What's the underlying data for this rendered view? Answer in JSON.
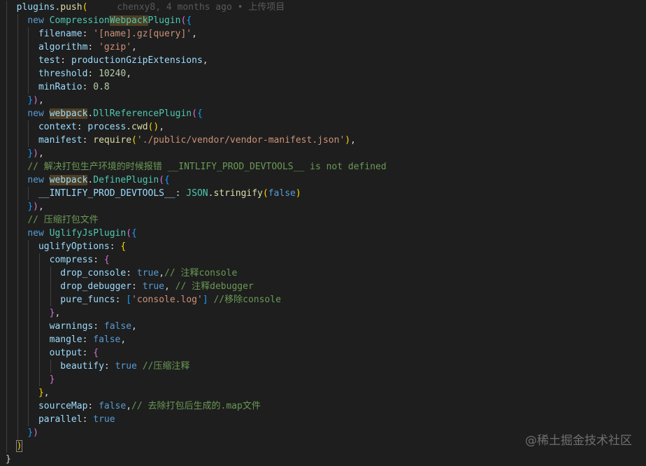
{
  "colors": {
    "background": "#1e1e1e",
    "default": "#d4d4d4",
    "keyword": "#569cd6",
    "class": "#4ec9b0",
    "function": "#dcdcaa",
    "property": "#9cdcfe",
    "string": "#ce9178",
    "number": "#b5cea8",
    "comment": "#6a9955",
    "bracket_gold": "#ffd700",
    "bracket_purple": "#da70d6",
    "bracket_blue": "#179fff",
    "blame": "#5a5a5a"
  },
  "blame": {
    "text": "chenxy8, 4 months ago • 上传项目"
  },
  "watermark": {
    "text": "@稀土掘金技术社区"
  },
  "lines": [
    {
      "indent": 2,
      "tokens": [
        [
          "plugins",
          "property"
        ],
        [
          ".",
          "default"
        ],
        [
          "push",
          "function"
        ],
        [
          "(",
          "bracket_gold"
        ]
      ],
      "blame": true
    },
    {
      "indent": 3,
      "tokens": [
        [
          "new ",
          "keyword"
        ],
        [
          "Compression",
          "class"
        ],
        [
          "Webpack",
          "class_hl"
        ],
        [
          "Plugin",
          "class"
        ],
        [
          "(",
          "bracket_purple"
        ],
        [
          "{",
          "bracket_blue"
        ]
      ]
    },
    {
      "indent": 4,
      "tokens": [
        [
          "filename",
          "property"
        ],
        [
          ": ",
          "default"
        ],
        [
          "'[name].gz[query]'",
          "string"
        ],
        [
          ",",
          "default"
        ]
      ]
    },
    {
      "indent": 4,
      "tokens": [
        [
          "algorithm",
          "property"
        ],
        [
          ": ",
          "default"
        ],
        [
          "'gzip'",
          "string"
        ],
        [
          ",",
          "default"
        ]
      ]
    },
    {
      "indent": 4,
      "tokens": [
        [
          "test",
          "property"
        ],
        [
          ": ",
          "default"
        ],
        [
          "productionGzipExtensions",
          "property"
        ],
        [
          ",",
          "default"
        ]
      ]
    },
    {
      "indent": 4,
      "tokens": [
        [
          "threshold",
          "property"
        ],
        [
          ": ",
          "default"
        ],
        [
          "10240",
          "number"
        ],
        [
          ",",
          "default"
        ]
      ]
    },
    {
      "indent": 4,
      "tokens": [
        [
          "minRatio",
          "property"
        ],
        [
          ": ",
          "default"
        ],
        [
          "0.8",
          "number"
        ]
      ]
    },
    {
      "indent": 3,
      "tokens": [
        [
          "}",
          "bracket_blue"
        ],
        [
          ")",
          "bracket_purple"
        ],
        [
          ",",
          "default"
        ]
      ]
    },
    {
      "indent": 3,
      "tokens": [
        [
          "new ",
          "keyword"
        ],
        [
          "webpack",
          "property_hl"
        ],
        [
          ".",
          "default"
        ],
        [
          "DllReferencePlugin",
          "class"
        ],
        [
          "(",
          "bracket_purple"
        ],
        [
          "{",
          "bracket_blue"
        ]
      ]
    },
    {
      "indent": 4,
      "tokens": [
        [
          "context",
          "property"
        ],
        [
          ": ",
          "default"
        ],
        [
          "process",
          "property"
        ],
        [
          ".",
          "default"
        ],
        [
          "cwd",
          "function"
        ],
        [
          "()",
          "bracket_gold"
        ],
        [
          ",",
          "default"
        ]
      ]
    },
    {
      "indent": 4,
      "tokens": [
        [
          "manifest",
          "property"
        ],
        [
          ": ",
          "default"
        ],
        [
          "require",
          "function"
        ],
        [
          "(",
          "bracket_gold"
        ],
        [
          "'./public/vendor/vendor-manifest.json'",
          "string"
        ],
        [
          ")",
          "bracket_gold"
        ],
        [
          ",",
          "default"
        ]
      ]
    },
    {
      "indent": 3,
      "tokens": [
        [
          "}",
          "bracket_blue"
        ],
        [
          ")",
          "bracket_purple"
        ],
        [
          ",",
          "default"
        ]
      ]
    },
    {
      "indent": 3,
      "tokens": [
        [
          "// 解决打包生产环境的时候报错 __INTLIFY_PROD_DEVTOOLS__ is not defined",
          "comment"
        ]
      ]
    },
    {
      "indent": 3,
      "tokens": [
        [
          "new ",
          "keyword"
        ],
        [
          "webpack",
          "property_hl"
        ],
        [
          ".",
          "default"
        ],
        [
          "DefinePlugin",
          "class"
        ],
        [
          "(",
          "bracket_purple"
        ],
        [
          "{",
          "bracket_blue"
        ]
      ]
    },
    {
      "indent": 4,
      "tokens": [
        [
          "__INTLIFY_PROD_DEVTOOLS__",
          "property"
        ],
        [
          ": ",
          "default"
        ],
        [
          "JSON",
          "class"
        ],
        [
          ".",
          "default"
        ],
        [
          "stringify",
          "function"
        ],
        [
          "(",
          "bracket_gold"
        ],
        [
          "false",
          "keyword"
        ],
        [
          ")",
          "bracket_gold"
        ]
      ]
    },
    {
      "indent": 3,
      "tokens": [
        [
          "}",
          "bracket_blue"
        ],
        [
          ")",
          "bracket_purple"
        ],
        [
          ",",
          "default"
        ]
      ]
    },
    {
      "indent": 3,
      "tokens": [
        [
          "// 压缩打包文件",
          "comment"
        ]
      ]
    },
    {
      "indent": 3,
      "tokens": [
        [
          "new ",
          "keyword"
        ],
        [
          "UglifyJsPlugin",
          "class"
        ],
        [
          "(",
          "bracket_purple"
        ],
        [
          "{",
          "bracket_blue"
        ]
      ]
    },
    {
      "indent": 4,
      "tokens": [
        [
          "uglifyOptions",
          "property"
        ],
        [
          ": ",
          "default"
        ],
        [
          "{",
          "bracket_gold"
        ]
      ]
    },
    {
      "indent": 5,
      "tokens": [
        [
          "compress",
          "property"
        ],
        [
          ": ",
          "default"
        ],
        [
          "{",
          "bracket_purple"
        ]
      ]
    },
    {
      "indent": 6,
      "tokens": [
        [
          "drop_console",
          "property"
        ],
        [
          ": ",
          "default"
        ],
        [
          "true",
          "keyword"
        ],
        [
          ",",
          "default"
        ],
        [
          "// 注释console",
          "comment"
        ]
      ]
    },
    {
      "indent": 6,
      "tokens": [
        [
          "drop_debugger",
          "property"
        ],
        [
          ": ",
          "default"
        ],
        [
          "true",
          "keyword"
        ],
        [
          ", ",
          "default"
        ],
        [
          "// 注释debugger",
          "comment"
        ]
      ]
    },
    {
      "indent": 6,
      "tokens": [
        [
          "pure_funcs",
          "property"
        ],
        [
          ": ",
          "default"
        ],
        [
          "[",
          "bracket_blue"
        ],
        [
          "'console.log'",
          "string"
        ],
        [
          "]",
          "bracket_blue"
        ],
        [
          " ",
          "default"
        ],
        [
          "//移除console",
          "comment"
        ]
      ]
    },
    {
      "indent": 5,
      "tokens": [
        [
          "}",
          "bracket_purple"
        ],
        [
          ",",
          "default"
        ]
      ]
    },
    {
      "indent": 5,
      "tokens": [
        [
          "warnings",
          "property"
        ],
        [
          ": ",
          "default"
        ],
        [
          "false",
          "keyword"
        ],
        [
          ",",
          "default"
        ]
      ]
    },
    {
      "indent": 5,
      "tokens": [
        [
          "mangle",
          "property"
        ],
        [
          ": ",
          "default"
        ],
        [
          "false",
          "keyword"
        ],
        [
          ",",
          "default"
        ]
      ]
    },
    {
      "indent": 5,
      "tokens": [
        [
          "output",
          "property"
        ],
        [
          ": ",
          "default"
        ],
        [
          "{",
          "bracket_purple"
        ]
      ]
    },
    {
      "indent": 6,
      "tokens": [
        [
          "beautify",
          "property"
        ],
        [
          ": ",
          "default"
        ],
        [
          "true",
          "keyword"
        ],
        [
          " ",
          "default"
        ],
        [
          "//压缩注释",
          "comment"
        ]
      ]
    },
    {
      "indent": 5,
      "tokens": [
        [
          "}",
          "bracket_purple"
        ]
      ]
    },
    {
      "indent": 4,
      "tokens": [
        [
          "}",
          "bracket_gold"
        ],
        [
          ",",
          "default"
        ]
      ]
    },
    {
      "indent": 4,
      "tokens": [
        [
          "sourceMap",
          "property"
        ],
        [
          ": ",
          "default"
        ],
        [
          "false",
          "keyword"
        ],
        [
          ",",
          "default"
        ],
        [
          "// 去除打包后生成的.map文件",
          "comment"
        ]
      ]
    },
    {
      "indent": 4,
      "tokens": [
        [
          "parallel",
          "property"
        ],
        [
          ": ",
          "default"
        ],
        [
          "true",
          "keyword"
        ]
      ]
    },
    {
      "indent": 3,
      "tokens": [
        [
          "}",
          "bracket_blue"
        ],
        [
          ")",
          "bracket_purple"
        ]
      ]
    },
    {
      "indent": 2,
      "tokens": [
        [
          ")",
          "bracket_gold_box"
        ]
      ]
    },
    {
      "indent": 1,
      "tokens": [
        [
          "}",
          "default"
        ]
      ]
    }
  ]
}
